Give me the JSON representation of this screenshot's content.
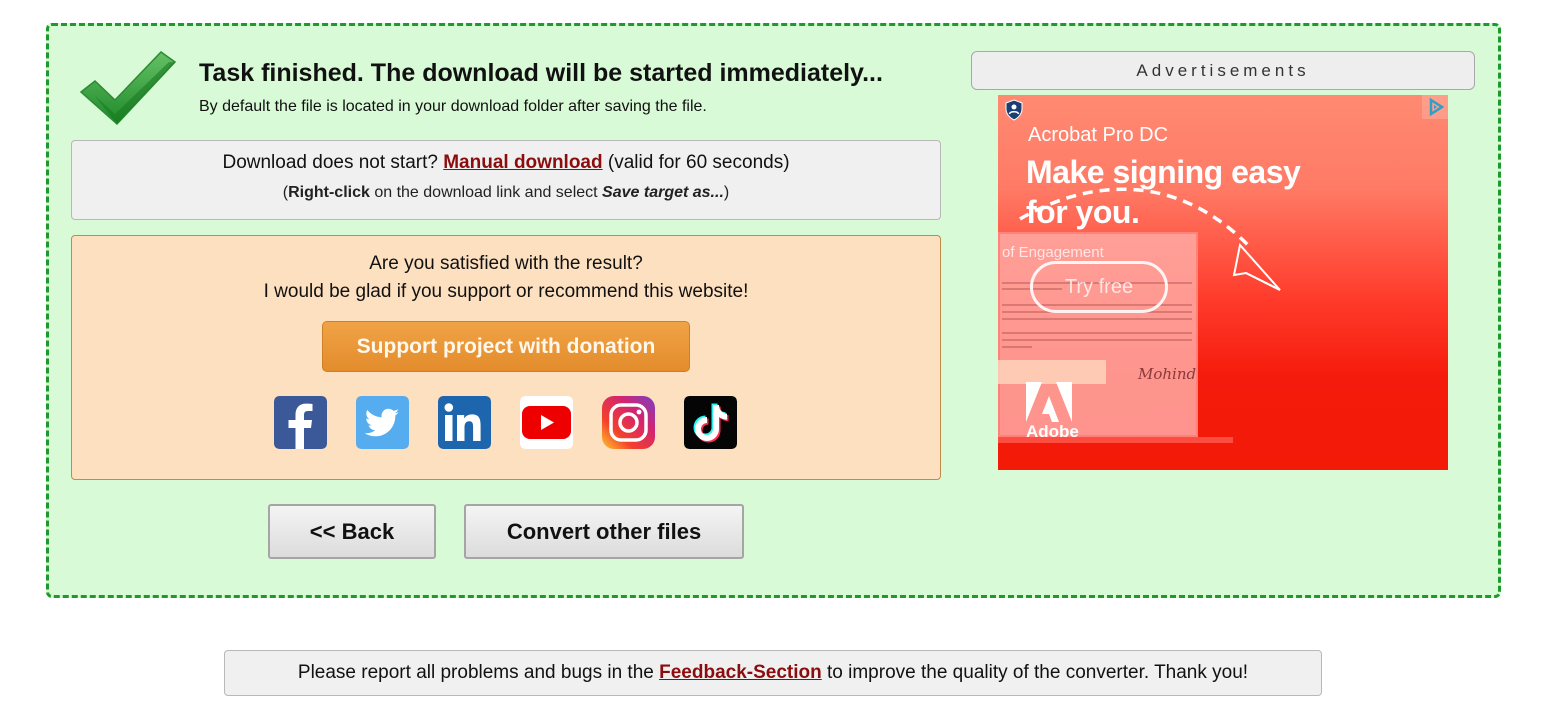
{
  "status": {
    "title": "Task finished. The download will be started immediately...",
    "subtitle": "By default the file is located in your download folder after saving the file.",
    "icon": "checkmark-icon",
    "accent_color": "#1c9a2b",
    "panel_color": "#d8fad6"
  },
  "manual_download": {
    "prefix": "Download does not start? ",
    "link_label": "Manual download",
    "suffix": " (valid for 60 seconds)",
    "hint_open": "(",
    "hint_bold": "Right-click",
    "hint_middle": " on the download link and select ",
    "hint_italic": "Save target as...",
    "hint_close": ")"
  },
  "support": {
    "line1": "Are you satisfied with the result?",
    "line2": "I would be glad if you support or recommend this website!",
    "donate_label": "Support project with donation",
    "donate_color": "#e8962f",
    "social": [
      {
        "name": "facebook",
        "icon": "facebook-icon",
        "color": "#3b5998"
      },
      {
        "name": "twitter",
        "icon": "twitter-icon",
        "color": "#55acee"
      },
      {
        "name": "linkedin",
        "icon": "linkedin-icon",
        "color": "#0e76a8"
      },
      {
        "name": "youtube",
        "icon": "youtube-icon",
        "color": "#ff0000"
      },
      {
        "name": "instagram",
        "icon": "instagram-icon",
        "color": "#c13584"
      },
      {
        "name": "tiktok",
        "icon": "tiktok-icon",
        "color": "#000000"
      }
    ]
  },
  "actions": {
    "back_label": "<< Back",
    "convert_label": "Convert other files"
  },
  "ads": {
    "header": "Advertisements",
    "product": "Acrobat Pro DC",
    "headline_line1": "Make signing easy",
    "headline_line2": "for you.",
    "doc_title": "of Engagement",
    "cta": "Try free",
    "brand": "Adobe",
    "signature": "Mohind"
  },
  "feedback": {
    "prefix": "Please report all problems and bugs in the ",
    "link_label": "Feedback-Section",
    "suffix": " to improve the quality of the converter. Thank you!"
  }
}
